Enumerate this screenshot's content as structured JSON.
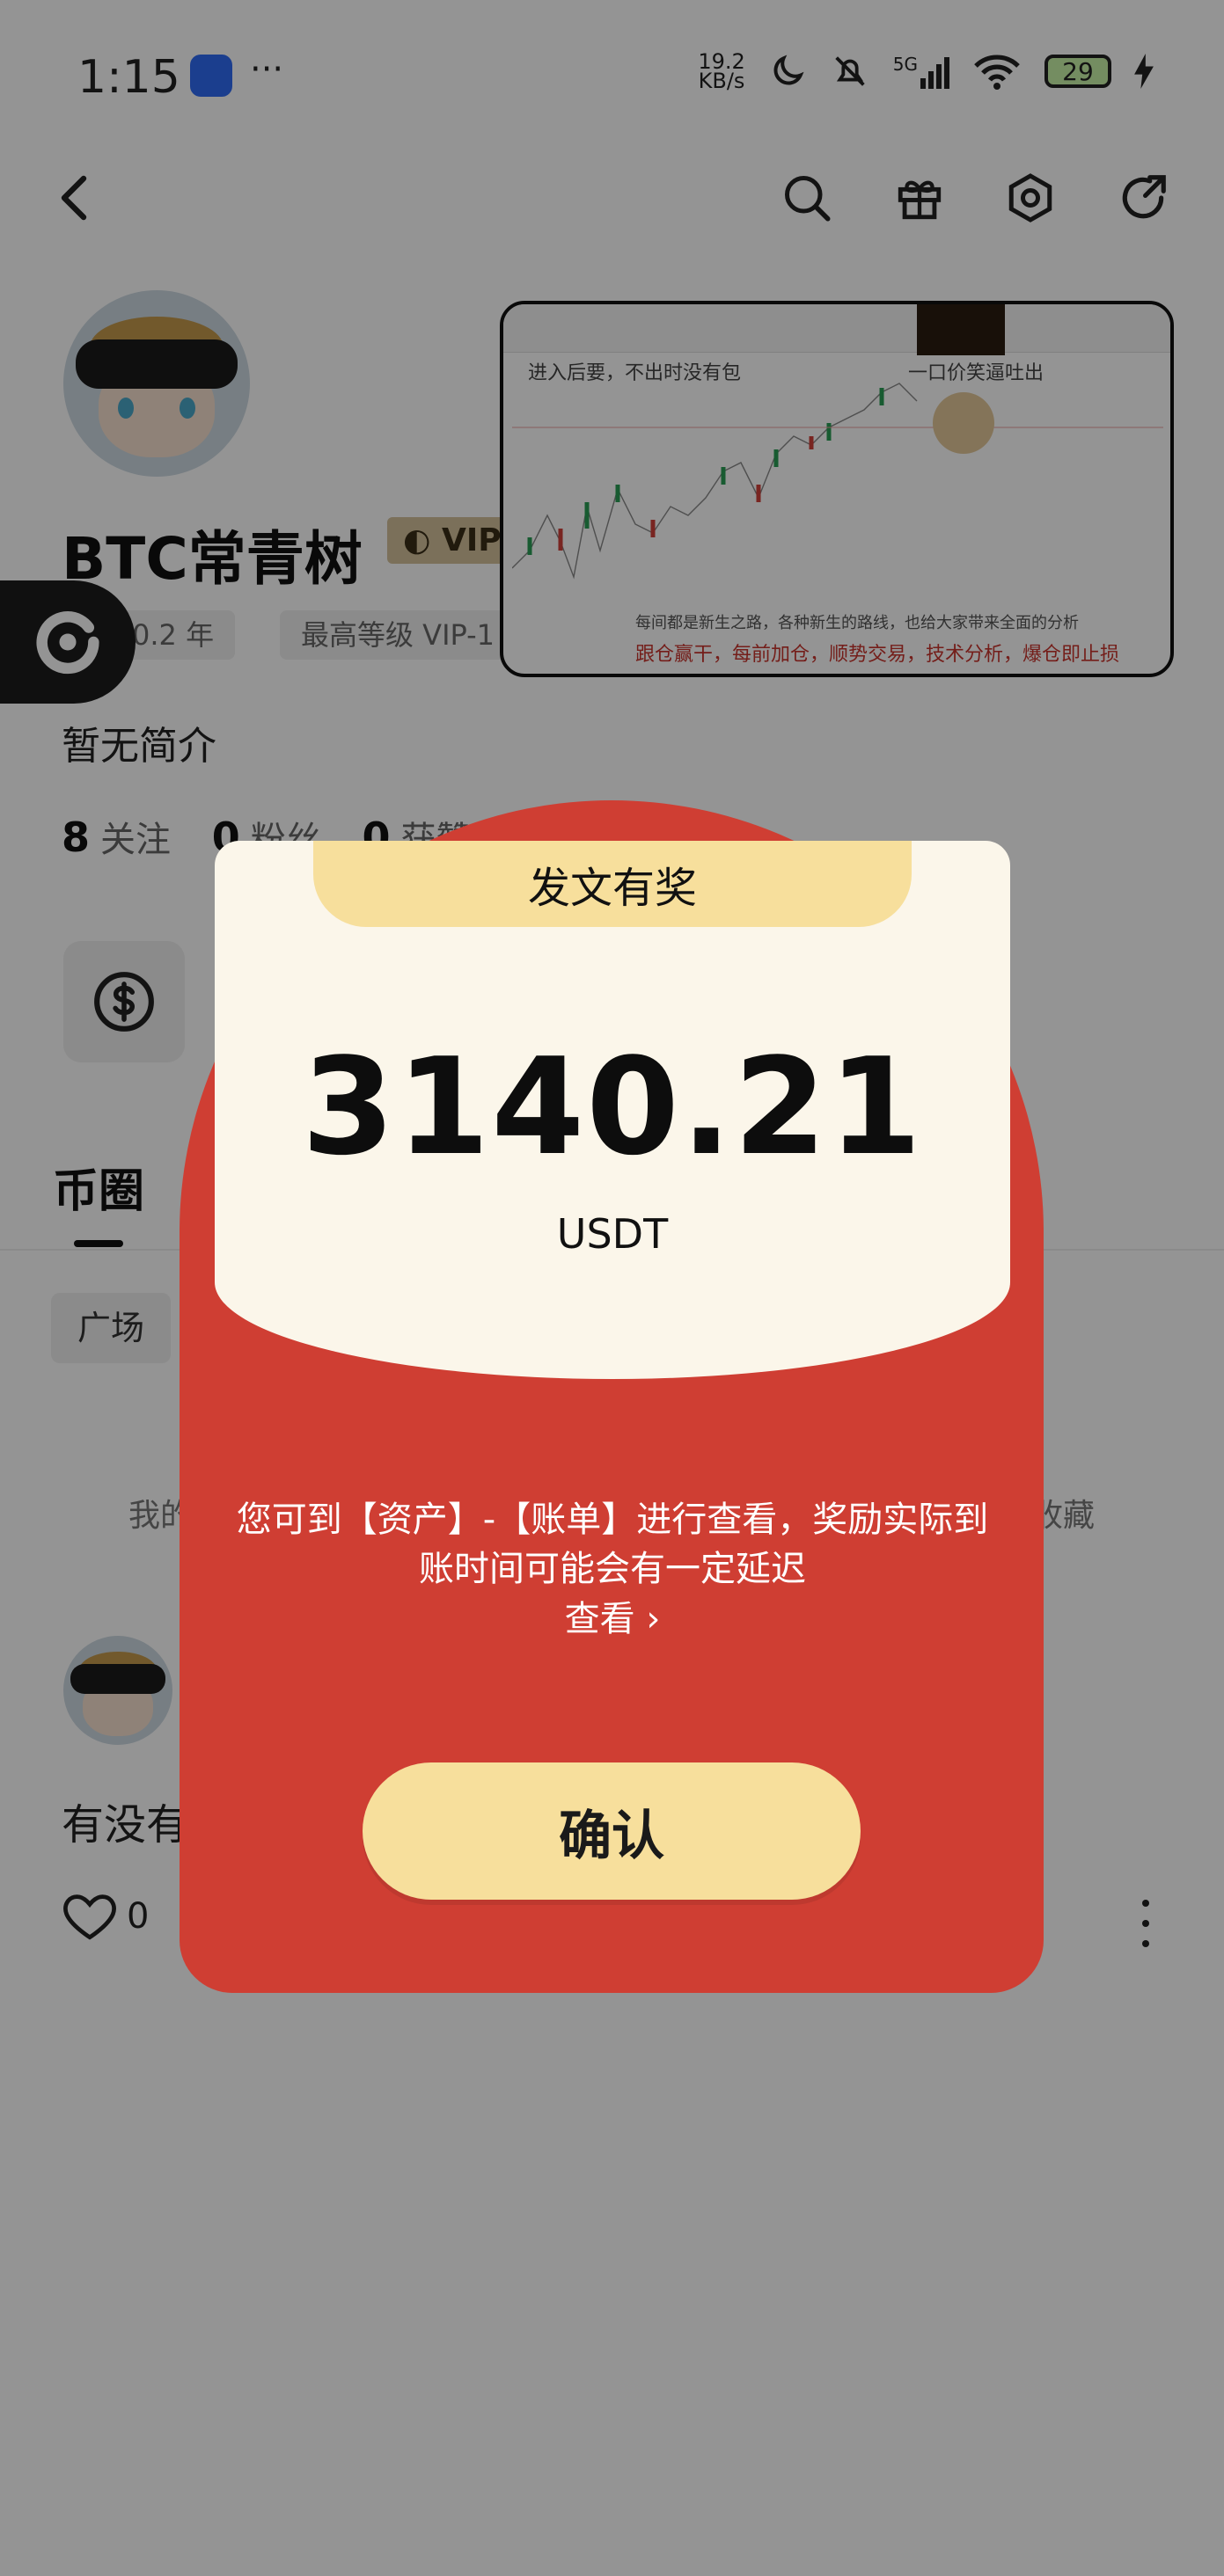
{
  "status_bar": {
    "time": "1:15",
    "net_speed_value": "19.2",
    "net_speed_unit": "KB/s",
    "signal": "5G",
    "battery": "29"
  },
  "profile": {
    "name": "BTC常青树",
    "vip_label": "VIP",
    "age_chip": "0.2 年",
    "level_chip": "最高等级 VIP-1",
    "bio": "暂无简介",
    "following_count": "8",
    "following_label": "关注",
    "followers_count": "0",
    "followers_label": "粉丝",
    "likes_count": "0",
    "likes_label": "获赞"
  },
  "tabs": {
    "main": "币圈"
  },
  "filter": {
    "label": "广场"
  },
  "partial_labels": {
    "left": "我的",
    "right": "收藏"
  },
  "post": {
    "text": "有没有",
    "like_count": "0"
  },
  "thumbnail": {
    "title_left": "进入后要，不出时没有包",
    "title_right": "一口价笑逼吐出",
    "caption": "每间都是新生之路，各种新生的路线，也给大家带来全面的分析",
    "red_text": "跟仓赢干，每前加仓，顺势交易，技术分析，爆仓即止损"
  },
  "modal": {
    "tab_title": "发文有奖",
    "amount": "3140.21",
    "currency": "USDT",
    "note_line1": "您可到【资产】-【账单】进行查看，奖励实际到",
    "note_line2": "账时间可能会有一定延迟",
    "view_link": "查看 ›",
    "confirm_label": "确认"
  },
  "colors": {
    "modal_red": "#cf3e33",
    "card_cream": "#fbf6ea",
    "button_gold": "#f7df9c",
    "vip_gold": "#d4c19c"
  },
  "icons": [
    "back-icon",
    "search-icon",
    "gift-icon",
    "settings-icon",
    "share-icon",
    "dollar-icon",
    "heart-icon",
    "more-icon",
    "app-notification-icon"
  ]
}
